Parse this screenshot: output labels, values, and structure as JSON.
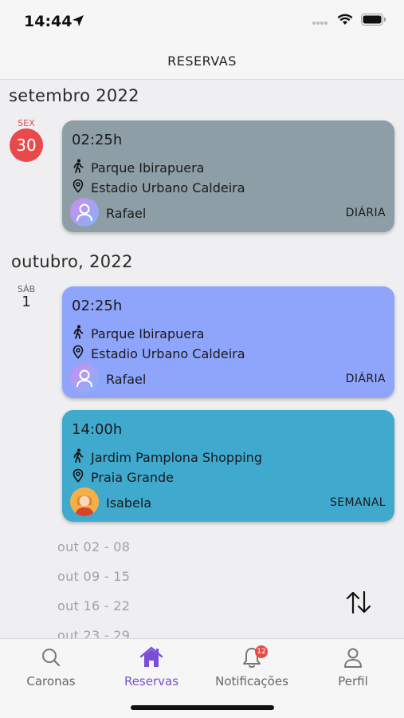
{
  "status": {
    "time": "14:44"
  },
  "header": {
    "title": "RESERVAS"
  },
  "months": [
    {
      "label": "setembro 2022",
      "day": {
        "abbr": "SEX",
        "num": "30",
        "highlight": true
      },
      "cards": [
        {
          "time": "02:25h",
          "origin": "Parque Ibirapuera",
          "destination": "Estadio Urbano Caldeira",
          "person": "Rafael",
          "frequency": "DIÁRIA",
          "color": "#8e9ea6"
        }
      ]
    },
    {
      "label": "outubro, 2022",
      "day": {
        "abbr": "SÁB",
        "num": "1",
        "highlight": false
      },
      "cards": [
        {
          "time": "02:25h",
          "origin": "Parque Ibirapuera",
          "destination": "Estadio Urbano Caldeira",
          "person": "Rafael",
          "frequency": "DIÁRIA",
          "color": "#8ea5fb"
        },
        {
          "time": "14:00h",
          "origin": "Jardim Pamplona Shopping",
          "destination": "Praia Grande",
          "person": "Isabela",
          "frequency": "SEMANAL",
          "color": "#3fa9ce"
        }
      ]
    }
  ],
  "weeks": [
    "out 02 - 08",
    "out 09 - 15",
    "out 16 - 22",
    "out 23 - 29"
  ],
  "tabs": [
    {
      "label": "Caronas",
      "icon": "search-icon",
      "active": false
    },
    {
      "label": "Reservas",
      "icon": "home-icon",
      "active": true
    },
    {
      "label": "Notificações",
      "icon": "bell-icon",
      "active": false,
      "badge": "12"
    },
    {
      "label": "Perfil",
      "icon": "person-icon",
      "active": false
    }
  ],
  "colors": {
    "accent": "#7a4ed8",
    "today": "#e84a4a"
  }
}
